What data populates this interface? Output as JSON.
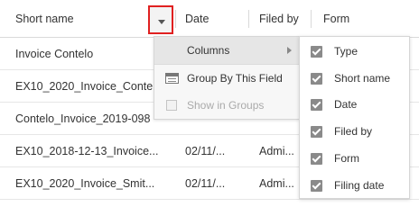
{
  "columns_header": {
    "short_name": "Short name",
    "date": "Date",
    "filed_by": "Filed by",
    "form": "Form"
  },
  "rows": [
    {
      "short_name": "Invoice Contelo",
      "date": "",
      "filed_by": ""
    },
    {
      "short_name": "EX10_2020_Invoice_Conte",
      "date": "",
      "filed_by": ""
    },
    {
      "short_name": "Contelo_Invoice_2019-098",
      "date": "",
      "filed_by": ""
    },
    {
      "short_name": "EX10_2018-12-13_Invoice...",
      "date": "02/11/...",
      "filed_by": "Admi..."
    },
    {
      "short_name": "EX10_2020_Invoice_Smit...",
      "date": "02/11/...",
      "filed_by": "Admi..."
    }
  ],
  "context_menu": {
    "items": [
      {
        "label": "Columns",
        "has_submenu": true,
        "active": true
      },
      {
        "label": "Group By This Field",
        "icon": "group-by-icon"
      },
      {
        "label": "Show in Groups",
        "disabled": true
      }
    ]
  },
  "columns_submenu": {
    "items": [
      {
        "label": "Type",
        "checked": true
      },
      {
        "label": "Short name",
        "checked": true
      },
      {
        "label": "Date",
        "checked": true
      },
      {
        "label": "Filed by",
        "checked": true
      },
      {
        "label": "Form",
        "checked": true
      },
      {
        "label": "Filing date",
        "checked": true
      }
    ]
  },
  "colors": {
    "highlight_border": "#e02020",
    "menu_bg": "#f7f7f7",
    "active_item_bg": "#e6e6e6",
    "checkbox": "#8a8a8a"
  }
}
